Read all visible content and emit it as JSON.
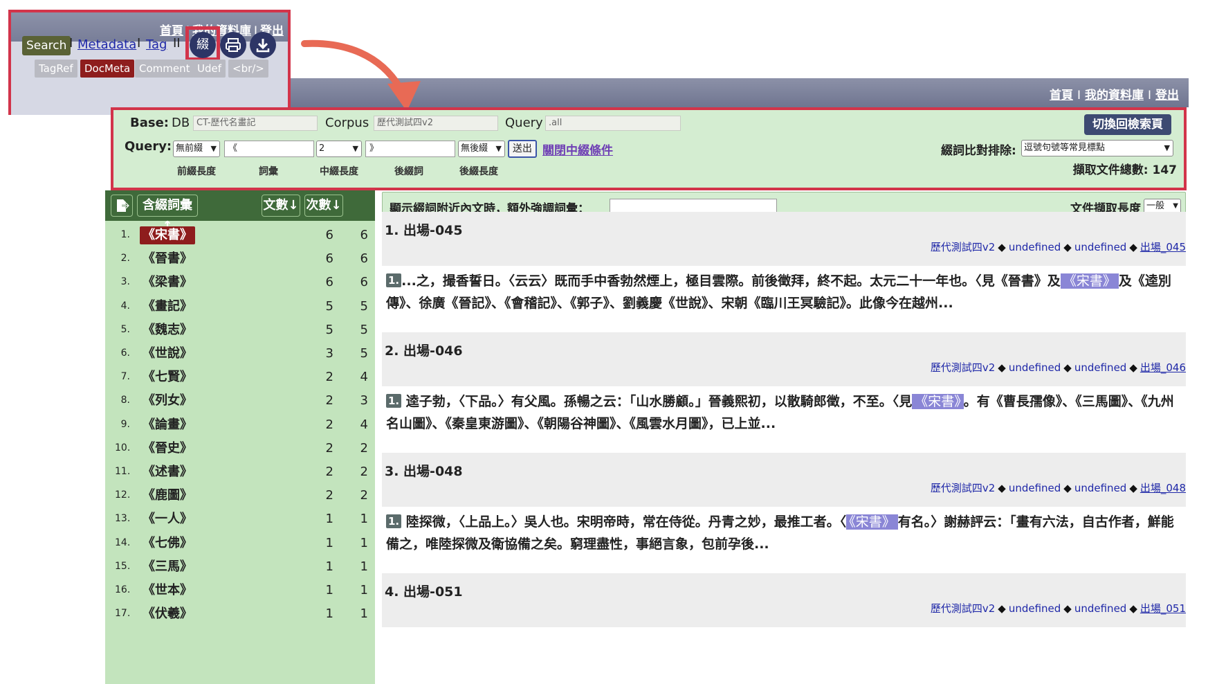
{
  "header": {
    "links": [
      "首頁",
      "我的資料庫",
      "登出"
    ]
  },
  "toolbar": {
    "search_label": "Search",
    "links": [
      "Metadata",
      "Tag"
    ],
    "icons": [
      "affix-icon",
      "print-icon",
      "download-icon"
    ],
    "affix_glyph": "綴",
    "chips": [
      "TagRef",
      "DocMeta",
      "Comment",
      "Udef",
      "<br/>"
    ],
    "active_chip": "DocMeta"
  },
  "query": {
    "base_label": "Base:",
    "db_label": "DB",
    "db_value": "CT-歷代名畫記",
    "corpus_label": "Corpus",
    "corpus_value": "歷代測試四v2",
    "query_label": "Query",
    "query_value": ".all",
    "query2_label": "Query:",
    "prefix_select": "無前綴",
    "term_input": "《",
    "middle_select": "2",
    "suffix_input": "》",
    "suffix_select": "無後綴",
    "submit_label": "送出",
    "close_link": "關閉中綴條件",
    "exclude_label": "綴詞比對排除:",
    "exclude_select": "逗號句號等常見標點",
    "switch_button": "切換回檢索頁",
    "total_label": "擷取文件總數: 147",
    "hints": [
      "前綴長度",
      "詞彙",
      "中綴長度",
      "後綴詞",
      "後綴長度"
    ]
  },
  "table": {
    "headers": {
      "term": "含綴詞彙↑",
      "docs": "文數↓",
      "count": "次數↓"
    },
    "rows": [
      {
        "n": "1.",
        "term": "《宋書》",
        "docs": "6",
        "count": "6"
      },
      {
        "n": "2.",
        "term": "《晉書》",
        "docs": "6",
        "count": "6"
      },
      {
        "n": "3.",
        "term": "《梁書》",
        "docs": "6",
        "count": "6"
      },
      {
        "n": "4.",
        "term": "《畫記》",
        "docs": "5",
        "count": "5"
      },
      {
        "n": "5.",
        "term": "《魏志》",
        "docs": "5",
        "count": "5"
      },
      {
        "n": "6.",
        "term": "《世說》",
        "docs": "3",
        "count": "5"
      },
      {
        "n": "7.",
        "term": "《七賢》",
        "docs": "2",
        "count": "4"
      },
      {
        "n": "8.",
        "term": "《列女》",
        "docs": "2",
        "count": "3"
      },
      {
        "n": "9.",
        "term": "《論畫》",
        "docs": "2",
        "count": "4"
      },
      {
        "n": "10.",
        "term": "《晉史》",
        "docs": "2",
        "count": "2"
      },
      {
        "n": "11.",
        "term": "《述書》",
        "docs": "2",
        "count": "2"
      },
      {
        "n": "12.",
        "term": "《鹿圖》",
        "docs": "2",
        "count": "2"
      },
      {
        "n": "13.",
        "term": "《一人》",
        "docs": "1",
        "count": "1"
      },
      {
        "n": "14.",
        "term": "《七佛》",
        "docs": "1",
        "count": "1"
      },
      {
        "n": "15.",
        "term": "《三馬》",
        "docs": "1",
        "count": "1"
      },
      {
        "n": "16.",
        "term": "《世本》",
        "docs": "1",
        "count": "1"
      },
      {
        "n": "17.",
        "term": "《伏羲》",
        "docs": "1",
        "count": "1"
      }
    ]
  },
  "results": {
    "emphasis_label": "顯示綴詞附近內文時，額外強調詞彙：",
    "length_label": "文件擷取長度",
    "length_select": "一般",
    "docs": [
      {
        "title": "1. 出場-045",
        "corpus": "歷代測試四v2",
        "m1": "undefined",
        "m2": "undefined",
        "link": "出場_045",
        "badge": "1.",
        "text_before": "...之，撮香誓日。〈云云〉既而手中香勃然煙上，極目雲際。前後徵拜，終不起。太元二十一年也。〈見《晉書》及",
        "keyword": "《宋書》",
        "text_after": "及《逵別傳》、徐廣《晉記》、《會稽記》、《郭子》、劉義慶《世說》、宋朝《臨川王冥驗記》。此像今在越州..."
      },
      {
        "title": "2. 出場-046",
        "corpus": "歷代測試四v2",
        "m1": "undefined",
        "m2": "undefined",
        "link": "出場_046",
        "badge": "1.",
        "text_before": " 逵子勃，〈下品。〉有父風。孫暢之云：「山水勝顧。」晉義熙初，以散騎郎徵，不至。〈見",
        "keyword": "《宋書》",
        "text_after": "。有《曹長孺像》、《三馬圖》、《九州名山圖》、《秦皇東游圖》、《朝陽谷神圖》、《風雲水月圖》，已上並..."
      },
      {
        "title": "3. 出場-048",
        "corpus": "歷代測試四v2",
        "m1": "undefined",
        "m2": "undefined",
        "link": "出場_048",
        "badge": "1.",
        "text_before": " 陸探微，〈上品上。〉吳人也。宋明帝時，常在侍從。丹青之妙，最推工者。〈",
        "keyword": "《宋書》",
        "text_after": "有名。〉謝赫評云：「畫有六法，自古作者，鮮能備之，唯陸探微及衛協備之矣。窮理盡性，事絕言象，包前孕後..."
      },
      {
        "title": "4. 出場-051",
        "corpus": "歷代測試四v2",
        "m1": "undefined",
        "m2": "undefined",
        "link": "出場_051",
        "badge": "",
        "text_before": "",
        "keyword": "",
        "text_after": ""
      }
    ]
  }
}
